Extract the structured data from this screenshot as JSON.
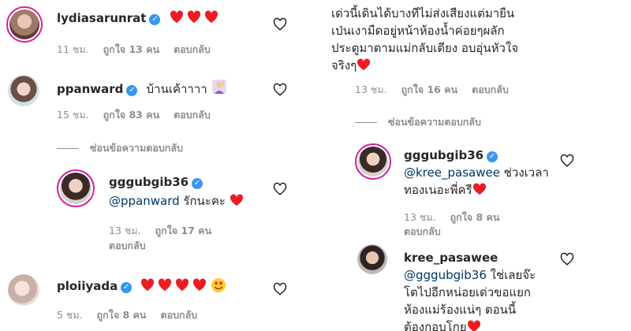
{
  "left": {
    "comments": [
      {
        "username": "lydiasarunrat",
        "text": "",
        "time": "11 ชม.",
        "likes": "ถูกใจ 13 คน",
        "reply": "ตอบกลับ"
      },
      {
        "username": "ppanward",
        "text": "บ้านเค้าาาา",
        "time": "15 ชม.",
        "likes": "ถูกใจ 83 คน",
        "reply": "ตอบกลับ"
      },
      {
        "username": "gggubgib36",
        "mention": "@ppanward",
        "text": "รักนะคะ",
        "time": "13 ชม.",
        "likes": "ถูกใจ 17 คน",
        "reply": "ตอบกลับ"
      },
      {
        "username": "ploiiyada",
        "text": "",
        "time": "5 ชม.",
        "likes": "ถูกใจ 8 คน",
        "reply": "ตอบกลับ"
      }
    ],
    "hide_replies": "ซ่อนข้อความตอบกลับ"
  },
  "right": {
    "top_text_line1": "เด่วนี้เดินได้บางทีไม่ส่งเสียงแต่มายืน",
    "top_text_line2": "เป่นเงามืดอยู่หน้าห้องน้ำค่อยๆผลัก",
    "top_text_line3": "ประตูมาตามแม่กลับเตียง อบอุ่นหัวใจ",
    "top_text_line4": "จริงๆ",
    "top_time": "13 ชม.",
    "top_likes": "ถูกใจ 16 คน",
    "top_reply": "ตอบกลับ",
    "hide_replies": "ซ่อนข้อความตอบกลับ",
    "reply1": {
      "username": "gggubgib36",
      "mention": "@kree_pasawee",
      "text_line1": "ช่วงเวลา",
      "text_line2": "ทองเนอะพี่ครี",
      "time": "13 ชม.",
      "likes": "ถูกใจ 8 คน",
      "reply": "ตอบกลับ"
    },
    "reply2": {
      "username": "kree_pasawee",
      "mention": "@gggubgib36",
      "text_line1": "ใช่เลยจ๊ะ",
      "text_line2": "โตไปอีกหน่อยเด่วขอแยก",
      "text_line3": "ห้องแม่ร้องแน่ๆ ตอนนี้",
      "text_line4": "ต้องกอบโกย"
    }
  },
  "colors": {
    "heart": "#ed1c24",
    "verified": "#3897f0",
    "mention": "#00376b",
    "meta": "#8e8e8e"
  }
}
